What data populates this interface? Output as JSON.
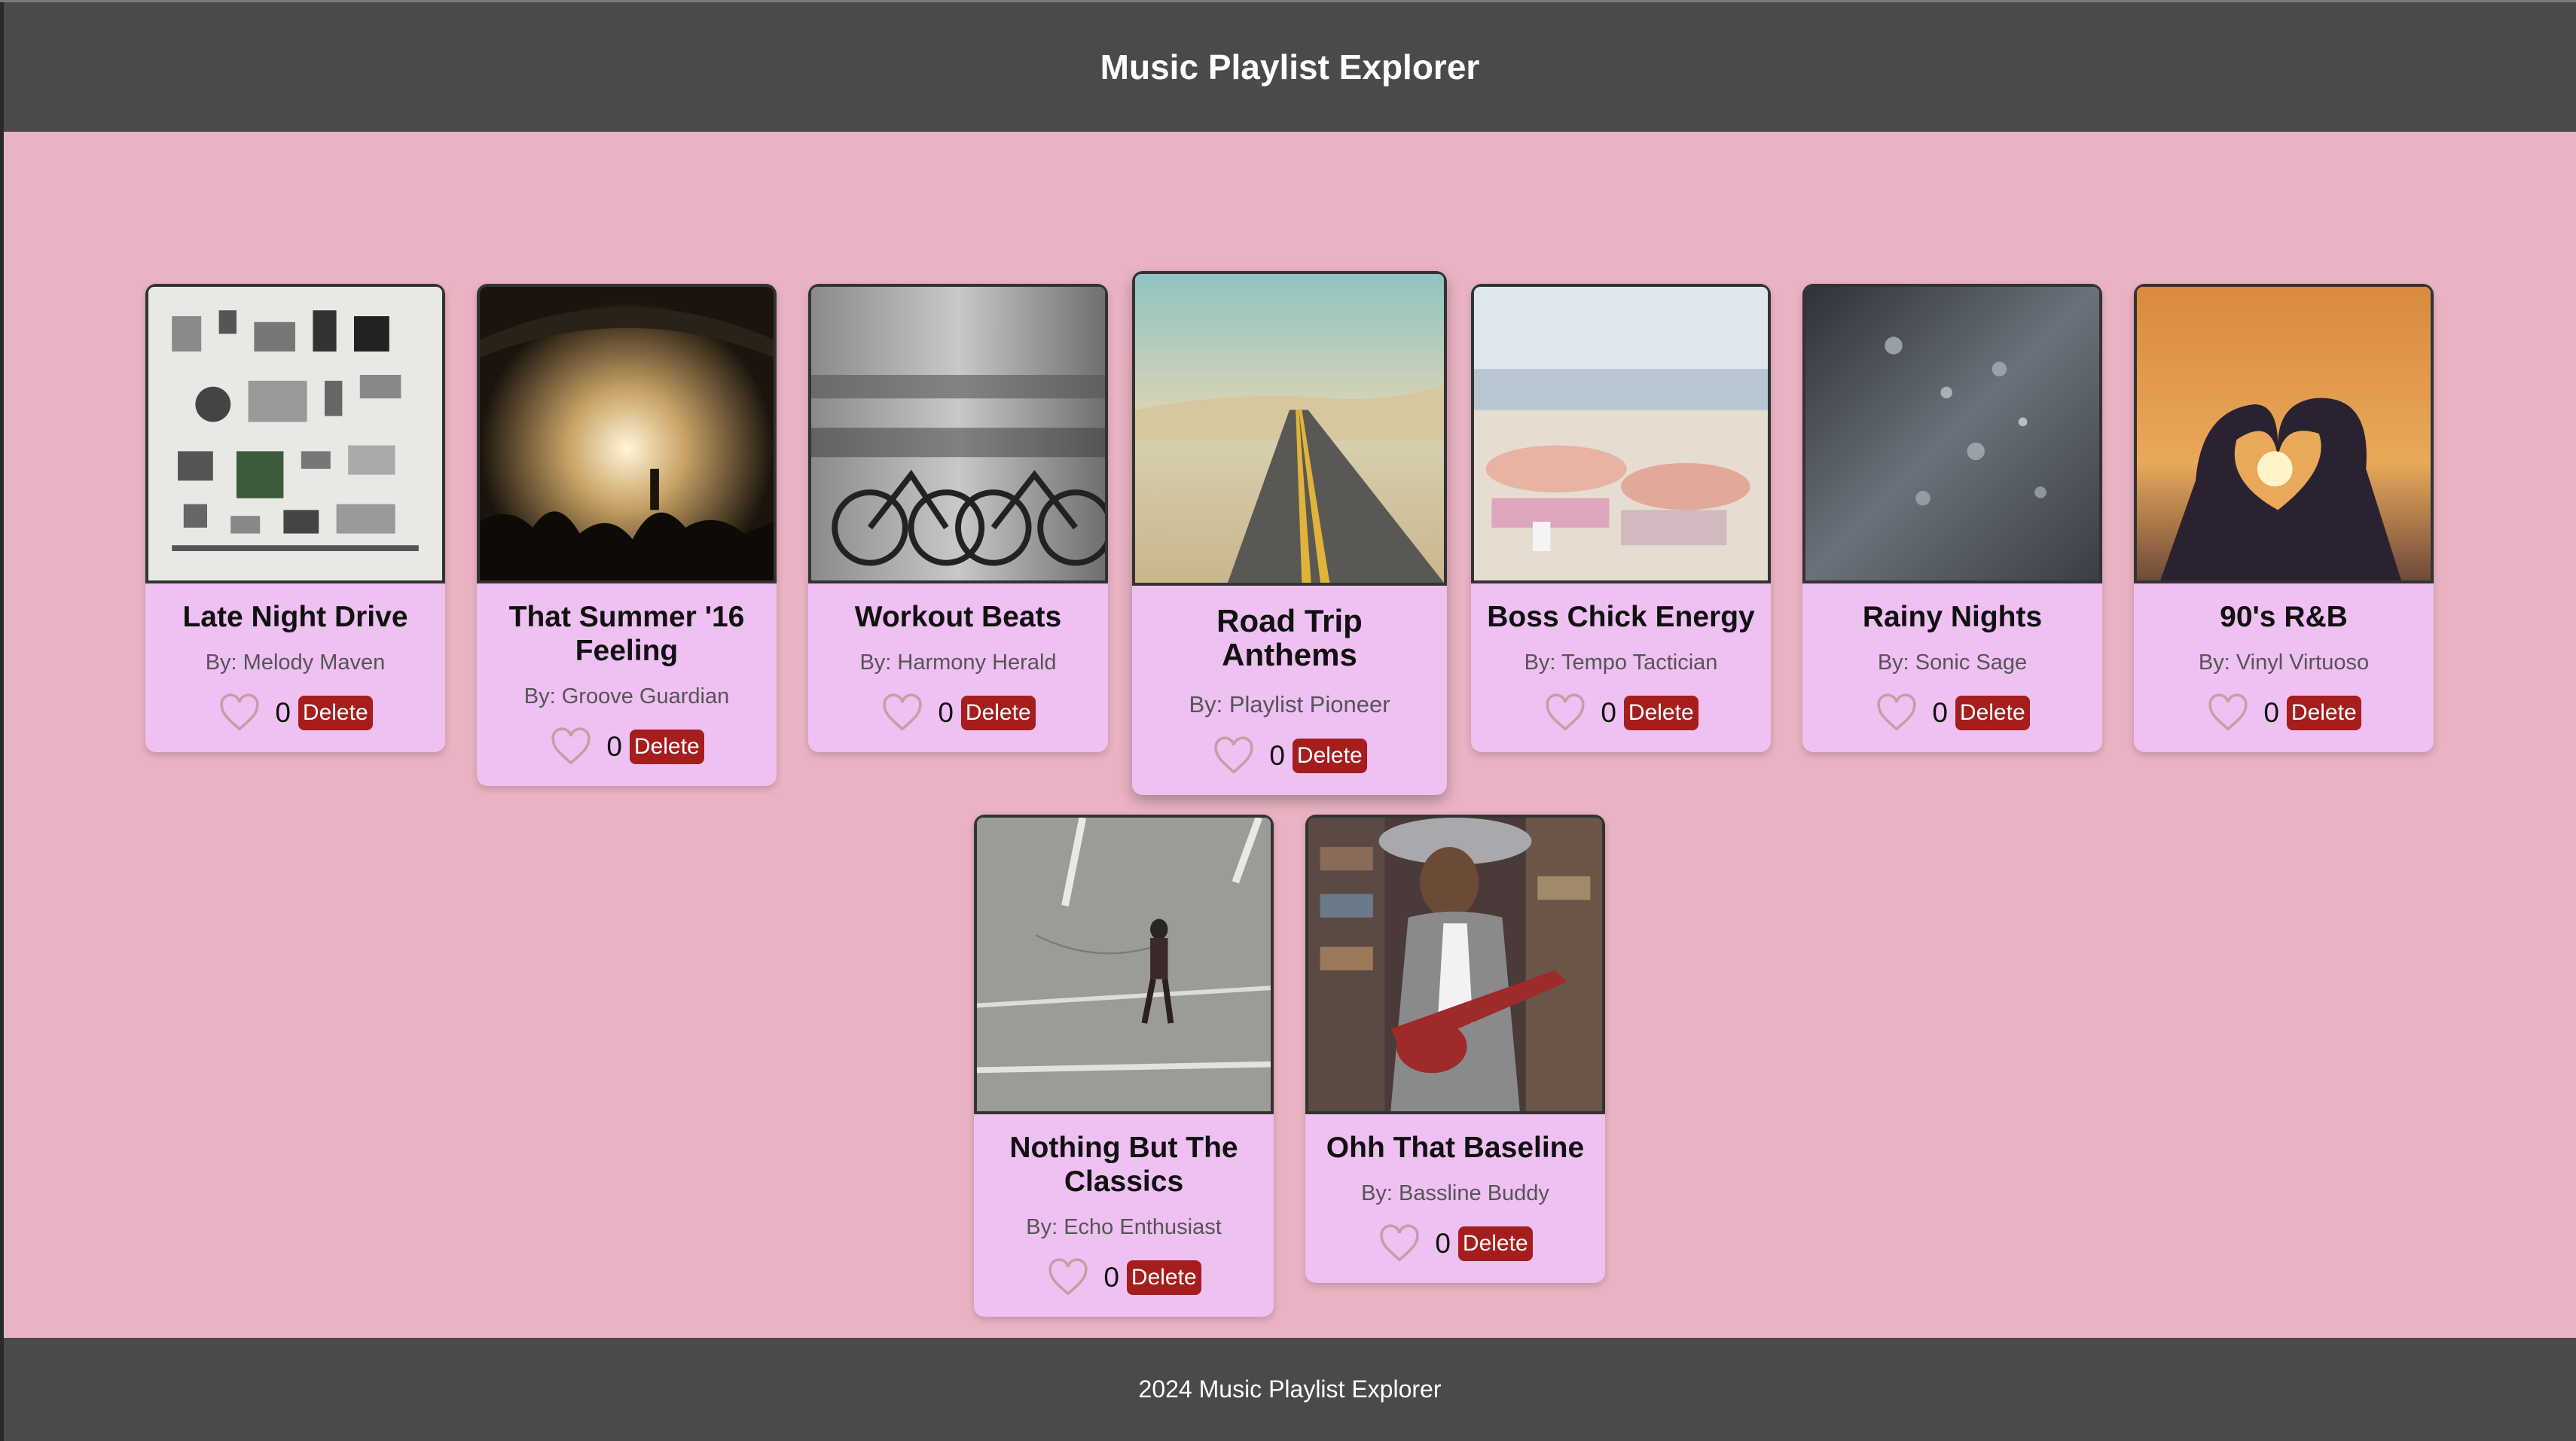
{
  "header": {
    "title": "Music Playlist Explorer"
  },
  "footer": {
    "text": "2024 Music Playlist Explorer"
  },
  "colors": {
    "header_bg": "#4a4a4a",
    "page_bg": "#eab3c3",
    "card_bg": "#efc0f2",
    "delete_button": "#a61d1d"
  },
  "playlists": [
    {
      "title": "Late Night Drive",
      "author": "By: Melody Maven",
      "likes": "0",
      "delete_label": "Delete",
      "image": "flat-lay-gadgets"
    },
    {
      "title": "That Summer '16 Feeling",
      "author": "By: Groove Guardian",
      "likes": "0",
      "delete_label": "Delete",
      "image": "concert-crowd"
    },
    {
      "title": "Workout Beats",
      "author": "By: Harmony Herald",
      "likes": "0",
      "delete_label": "Delete",
      "image": "cyclists-blur"
    },
    {
      "title": "Road Trip Anthems",
      "author": "By: Playlist Pioneer",
      "likes": "0",
      "delete_label": "Delete",
      "image": "desert-road"
    },
    {
      "title": "Boss Chick Energy",
      "author": "By: Tempo Tactician",
      "likes": "0",
      "delete_label": "Delete",
      "image": "beach-sunbathing"
    },
    {
      "title": "Rainy Nights",
      "author": "By: Sonic Sage",
      "likes": "0",
      "delete_label": "Delete",
      "image": "rain-on-glass"
    },
    {
      "title": "90's R&B",
      "author": "By: Vinyl Virtuoso",
      "likes": "0",
      "delete_label": "Delete",
      "image": "heart-hands-sunset"
    },
    {
      "title": "Nothing But The Classics",
      "author": "By: Echo Enthusiast",
      "likes": "0",
      "delete_label": "Delete",
      "image": "man-crossing-street"
    },
    {
      "title": "Ohh That Baseline",
      "author": "By: Bassline Buddy",
      "likes": "0",
      "delete_label": "Delete",
      "image": "woman-guitar-store"
    }
  ]
}
